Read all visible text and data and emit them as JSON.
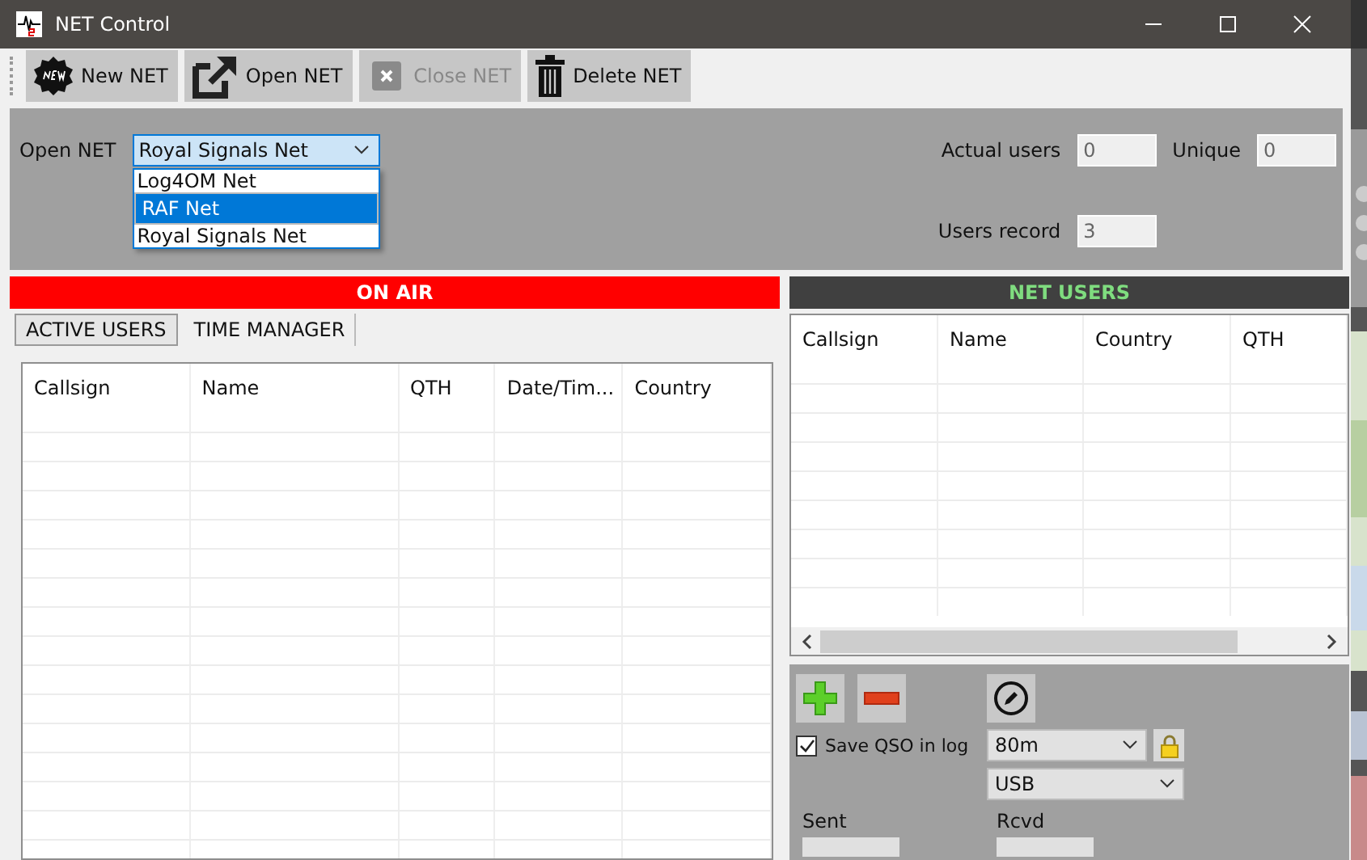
{
  "window": {
    "title": "NET Control"
  },
  "toolbar": [
    {
      "label": "New NET",
      "kind": "new",
      "disabled": false
    },
    {
      "label": "Open NET",
      "kind": "open",
      "disabled": false
    },
    {
      "label": "Close NET",
      "kind": "close",
      "disabled": true
    },
    {
      "label": "Delete NET",
      "kind": "delete",
      "disabled": false
    }
  ],
  "net_selector": {
    "label": "Open NET",
    "value": "Royal Signals Net",
    "expanded": true,
    "options": [
      {
        "label": "Log4OM Net",
        "highlighted": false
      },
      {
        "label": "RAF Net",
        "highlighted": true
      },
      {
        "label": "Royal Signals Net",
        "highlighted": false
      }
    ]
  },
  "stats": [
    {
      "label": "Actual users",
      "value": "0"
    },
    {
      "label": "Unique",
      "value": "0"
    },
    {
      "label": "Users record",
      "value": "3"
    }
  ],
  "on_air": {
    "title": "ON AIR",
    "tabs": [
      {
        "label": "ACTIVE USERS",
        "selected": true
      },
      {
        "label": "TIME MANAGER",
        "selected": false
      }
    ],
    "table": {
      "columns": [
        "Callsign",
        "Name",
        "QTH",
        "Date/Tim...",
        "Country"
      ]
    }
  },
  "net_users": {
    "title": "NET USERS",
    "table": {
      "columns": [
        "Callsign",
        "Name",
        "Country",
        "QTH"
      ]
    }
  },
  "controls": {
    "save_qso": {
      "label": "Save QSO in log",
      "checked": true
    },
    "band": "80m",
    "mode": "USB",
    "sent_label": "Sent",
    "rcvd_label": "Rcvd"
  }
}
